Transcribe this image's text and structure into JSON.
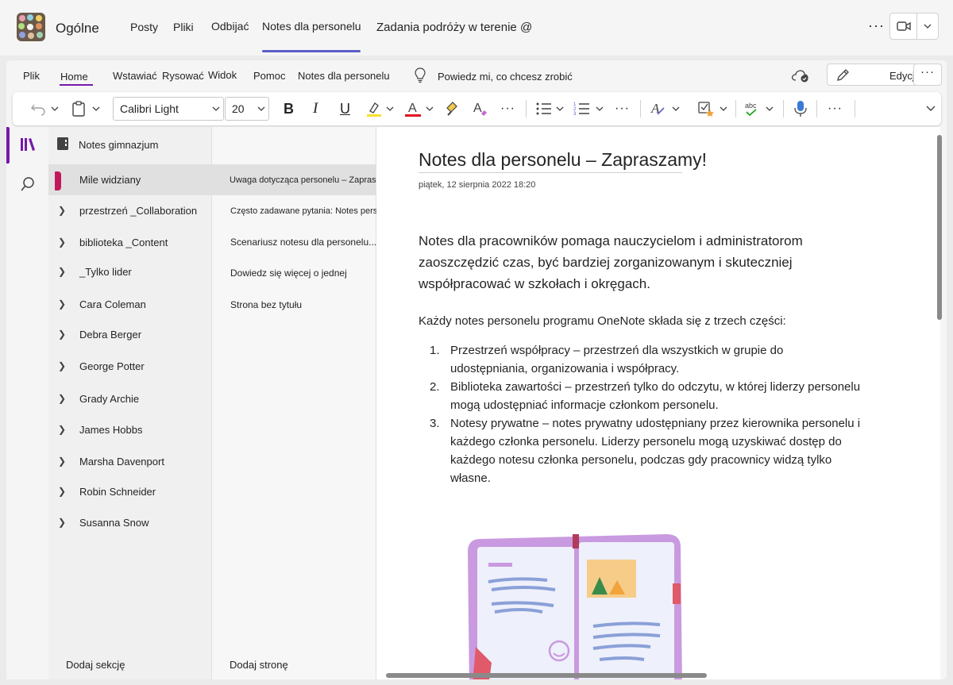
{
  "header": {
    "channel_name": "Ogólne",
    "tabs": [
      {
        "label": "Posty"
      },
      {
        "label": "Pliki"
      },
      {
        "label": "Odbijać"
      },
      {
        "label": "Notes dla personelu"
      },
      {
        "label": "Zadania podróży w terenie @"
      }
    ],
    "active_tab_index": 3,
    "more": "···",
    "accent_color": "#5b5fc7"
  },
  "ribbon": {
    "tabs": [
      {
        "label": "Plik"
      },
      {
        "label": "Home"
      },
      {
        "label": "Wstawiać"
      },
      {
        "label": "Rysować"
      },
      {
        "label": "Widok"
      },
      {
        "label": "Pomoc"
      },
      {
        "label": "Notes dla personelu"
      }
    ],
    "active_tab": "Home",
    "tell_me": "Powiedz mi, co chcesz zrobić",
    "edit_label": "Edycji",
    "more": "···",
    "font_name": "Calibri Light",
    "font_size": "20",
    "accent_color": "#7719aa",
    "icons": [
      "undo-icon",
      "clipboard-icon",
      "bold-icon",
      "italic-icon",
      "underline-icon",
      "highlight-icon",
      "font-color-icon",
      "format-painter-icon",
      "clear-format-icon",
      "bullets-icon",
      "numbering-icon",
      "styles-icon",
      "tag-icon",
      "spelling-icon",
      "dictate-icon"
    ]
  },
  "sections": {
    "notebook_name": "Notes gimnazjum",
    "items": [
      {
        "label": "Mile widziany",
        "selected": true,
        "expandable": false
      },
      {
        "label": "przestrzeń _Collaboration",
        "expandable": true
      },
      {
        "label": "biblioteka _Content",
        "expandable": true
      },
      {
        "label": "_Tylko lider",
        "expandable": true
      },
      {
        "label": "Cara Coleman",
        "expandable": true
      },
      {
        "label": "Debra Berger",
        "expandable": true
      },
      {
        "label": "George Potter",
        "expandable": true
      },
      {
        "label": "Grady Archie",
        "expandable": true
      },
      {
        "label": "James Hobbs",
        "expandable": true
      },
      {
        "label": "Marsha Davenport",
        "expandable": true
      },
      {
        "label": "Robin Schneider",
        "expandable": true
      },
      {
        "label": "Susanna Snow",
        "expandable": true
      }
    ],
    "add_label": "Dodaj sekcję",
    "section_color": "#c2185b"
  },
  "pages": {
    "items": [
      {
        "label": "Uwaga dotycząca personelu – Zapraszamy!",
        "selected": true
      },
      {
        "label": "Często zadawane pytania: Notes personelu w ..."
      },
      {
        "label": "Scenariusz notesu dla personelu..."
      },
      {
        "label": "Dowiedz się więcej o jednej"
      },
      {
        "label": "Strona bez tytułu"
      }
    ],
    "add_label": "Dodaj stronę"
  },
  "page": {
    "title": "Notes dla personelu – Zapraszamy!",
    "date": "piątek, 12 sierpnia 2022 18:20",
    "lead": "Notes dla pracowników pomaga nauczycielom i administratorom zaoszczędzić czas, być bardziej zorganizowanym i skuteczniej współpracować w szkołach i okręgach.",
    "intro": "Każdy notes personelu programu OneNote składa się z trzech części:",
    "list": [
      {
        "num": "1.",
        "text": "Przestrzeń współpracy – przestrzeń dla wszystkich w grupie do udostępniania, organizowania i współpracy."
      },
      {
        "num": "2.",
        "text": "Biblioteka zawartości – przestrzeń tylko do odczytu, w której liderzy personelu mogą udostępniać informacje członkom personelu."
      },
      {
        "num": "3.",
        "text": "Notesy prywatne – notes prywatny udostępniany przez kierownika personelu i każdego członka personelu. Liderzy personelu mogą uzyskiwać dostęp do każdego notesu członka personelu, podczas gdy pracownicy widzą tylko własne."
      }
    ]
  }
}
